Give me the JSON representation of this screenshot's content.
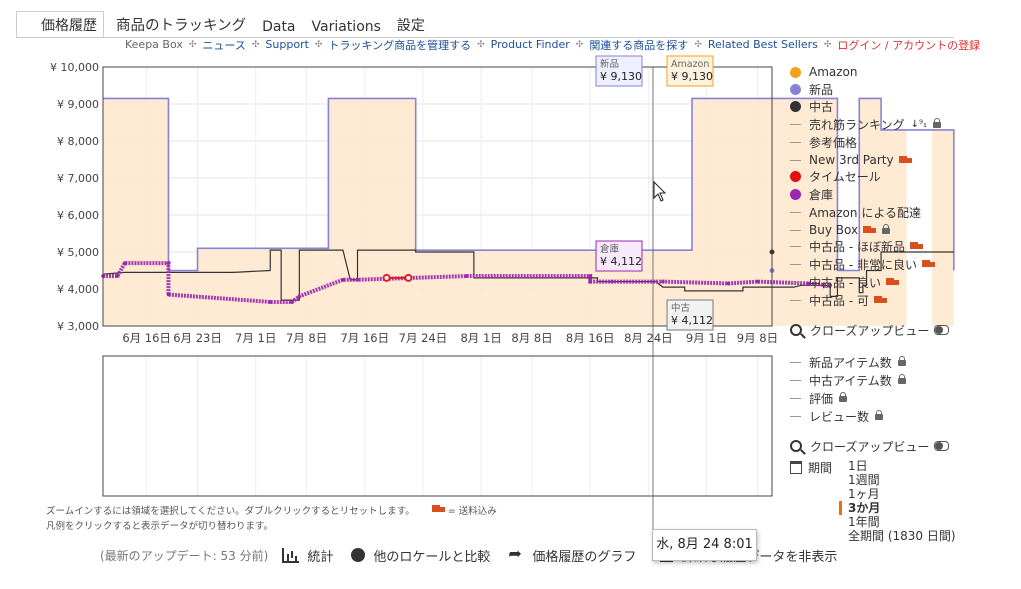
{
  "tabs": [
    "価格履歴",
    "商品のトラッキング",
    "Data",
    "Variations",
    "設定"
  ],
  "sublinks": [
    {
      "label": "Keepa Box",
      "style": "gray"
    },
    {
      "label": "ニュース",
      "style": "blue"
    },
    {
      "label": "Support",
      "style": "blue"
    },
    {
      "label": "トラッキング商品を管理する",
      "style": "blue"
    },
    {
      "label": "Product Finder",
      "style": "blue"
    },
    {
      "label": "関連する商品を探す",
      "style": "blue"
    },
    {
      "label": "Related Best Sellers",
      "style": "blue"
    },
    {
      "label": "ログイン / アカウントの登録",
      "style": "red"
    }
  ],
  "chart": {
    "y_ticks": [
      "¥ 10,000",
      "¥ 9,000",
      "¥ 8,000",
      "¥ 7,000",
      "¥ 6,000",
      "¥ 5,000",
      "¥ 4,000",
      "¥ 3,000"
    ],
    "x_ticks": [
      "6月 16日",
      "6月 23日",
      "7月 1日",
      "7月 8日",
      "7月 16日",
      "7月 24日",
      "8月 1日",
      "8月 8日",
      "8月 16日",
      "8月 24日",
      "9月 1日",
      "9月 8日"
    ],
    "callouts": {
      "new": {
        "label": "新品",
        "value": "¥ 9,130"
      },
      "amazon": {
        "label": "Amazon",
        "value": "¥ 9,130"
      },
      "warehouse": {
        "label": "倉庫",
        "value": "¥ 4,112"
      },
      "used": {
        "label": "中古",
        "value": "¥ 4,112"
      }
    },
    "hover_time": "水, 8月 24 8:01"
  },
  "chart_data": {
    "type": "line",
    "ylim": [
      3000,
      10000
    ],
    "x_domain": [
      "6月 10日",
      "9月 10日"
    ],
    "series": [
      {
        "name": "新品",
        "color": "#8a82d8",
        "points": [
          [
            0,
            9150
          ],
          [
            9,
            9150
          ],
          [
            9,
            4500
          ],
          [
            13,
            4500
          ],
          [
            13,
            5100
          ],
          [
            31,
            5100
          ],
          [
            31,
            9150
          ],
          [
            43,
            9150
          ],
          [
            43,
            5050
          ],
          [
            81,
            5050
          ],
          [
            81,
            9150
          ],
          [
            101,
            9150
          ],
          [
            101,
            4500
          ],
          [
            104,
            4500
          ],
          [
            104,
            9150
          ],
          [
            107,
            9150
          ],
          [
            107,
            8300
          ],
          [
            112,
            8300
          ],
          [
            113,
            8300
          ],
          [
            117,
            8300
          ],
          [
            117,
            4500
          ]
        ]
      },
      {
        "name": "中古",
        "color": "#333333",
        "points": [
          [
            0,
            4400
          ],
          [
            3,
            4450
          ],
          [
            13,
            4450
          ],
          [
            18,
            4450
          ],
          [
            23,
            4500
          ],
          [
            23,
            5050
          ],
          [
            24.5,
            5050
          ],
          [
            24.5,
            3700
          ],
          [
            27,
            3700
          ],
          [
            27,
            5050
          ],
          [
            33,
            5050
          ],
          [
            34,
            4250
          ],
          [
            35,
            4250
          ],
          [
            35,
            5050
          ],
          [
            43,
            5050
          ],
          [
            43,
            5000
          ],
          [
            51,
            5000
          ],
          [
            51,
            4300
          ],
          [
            68,
            4300
          ],
          [
            68,
            4200
          ],
          [
            76,
            4200
          ],
          [
            77,
            4050
          ],
          [
            80,
            4050
          ],
          [
            80,
            3950
          ],
          [
            88,
            3950
          ],
          [
            88,
            4050
          ],
          [
            95,
            4050
          ],
          [
            96,
            4100
          ],
          [
            100,
            4100
          ],
          [
            100,
            3800
          ],
          [
            101,
            3800
          ],
          [
            101,
            4300
          ],
          [
            104,
            4300
          ],
          [
            104,
            3900
          ],
          [
            104.5,
            3900
          ],
          [
            104.5,
            4100
          ],
          [
            105,
            4100
          ],
          [
            105,
            4500
          ],
          [
            107,
            4500
          ],
          [
            107,
            5000
          ],
          [
            117,
            5000
          ]
        ]
      },
      {
        "name": "倉庫",
        "color": "#9b27b0",
        "points": [
          [
            0,
            4350
          ],
          [
            2,
            4350
          ],
          [
            3,
            4700
          ],
          [
            9,
            4700
          ],
          [
            9,
            3850
          ],
          [
            23,
            3650
          ],
          [
            26,
            3650
          ],
          [
            27,
            3800
          ],
          [
            33,
            4250
          ],
          [
            35,
            4250
          ],
          [
            50,
            4350
          ],
          [
            67,
            4350
          ],
          [
            67,
            4200
          ],
          [
            70,
            4200
          ],
          [
            77,
            4200
          ],
          [
            86,
            4150
          ],
          [
            90,
            4200
          ],
          [
            97,
            4150
          ],
          [
            100,
            4100
          ]
        ]
      },
      {
        "name": "タイムセール",
        "color": "#e02020",
        "points": [
          [
            39,
            4300
          ],
          [
            42,
            4300
          ]
        ]
      }
    ]
  },
  "legend": [
    {
      "label": "Amazon",
      "marker": "dot",
      "color": "#f5a21b"
    },
    {
      "label": "新品",
      "marker": "dot",
      "color": "#8a82d8"
    },
    {
      "label": "中古",
      "marker": "dot",
      "color": "#333333"
    },
    {
      "label": "売れ筋ランキング",
      "marker": "dash",
      "extra": "rank-lock"
    },
    {
      "label": "参考価格",
      "marker": "dash"
    },
    {
      "label": "New 3rd Party",
      "marker": "dash",
      "extra": "truck"
    },
    {
      "label": "タイムセール",
      "marker": "dot",
      "color": "#e01010"
    },
    {
      "label": "倉庫",
      "marker": "dot",
      "color": "#9b27b0"
    },
    {
      "label": "Amazon による配達",
      "marker": "dash"
    },
    {
      "label": "Buy Box",
      "marker": "dash",
      "extra": "truck-lock"
    },
    {
      "label": "中古品 - ほぼ新品",
      "marker": "dash",
      "extra": "truck"
    },
    {
      "label": "中古品 - 非常に良い",
      "marker": "dash",
      "extra": "truck"
    },
    {
      "label": "中古品 - 良い",
      "marker": "dash",
      "extra": "truck"
    },
    {
      "label": "中古品 - 可",
      "marker": "dash",
      "extra": "truck"
    }
  ],
  "closeup_label": "クローズアップビュー",
  "legend2": [
    "新品アイテム数",
    "中古アイテム数",
    "評価",
    "レビュー数"
  ],
  "period": {
    "label": "期間",
    "options": [
      "1日",
      "1週間",
      "1ヶ月",
      "3か月",
      "1年間",
      "全期間 (1830 日間)"
    ],
    "selected": "3か月"
  },
  "notes": [
    "ズームインするには領域を選択してください。ダブルクリックするとリセットします。",
    "= 送料込み",
    "凡例をクリックすると表示データが切り替わります。"
  ],
  "bottom": {
    "updated": "(最新のアップデート: 53 分前)",
    "stats": "統計",
    "compare": "他のロケールと比較",
    "share": "価格履歴のグラフ",
    "hide": "詳細な履歴データを非表示"
  }
}
